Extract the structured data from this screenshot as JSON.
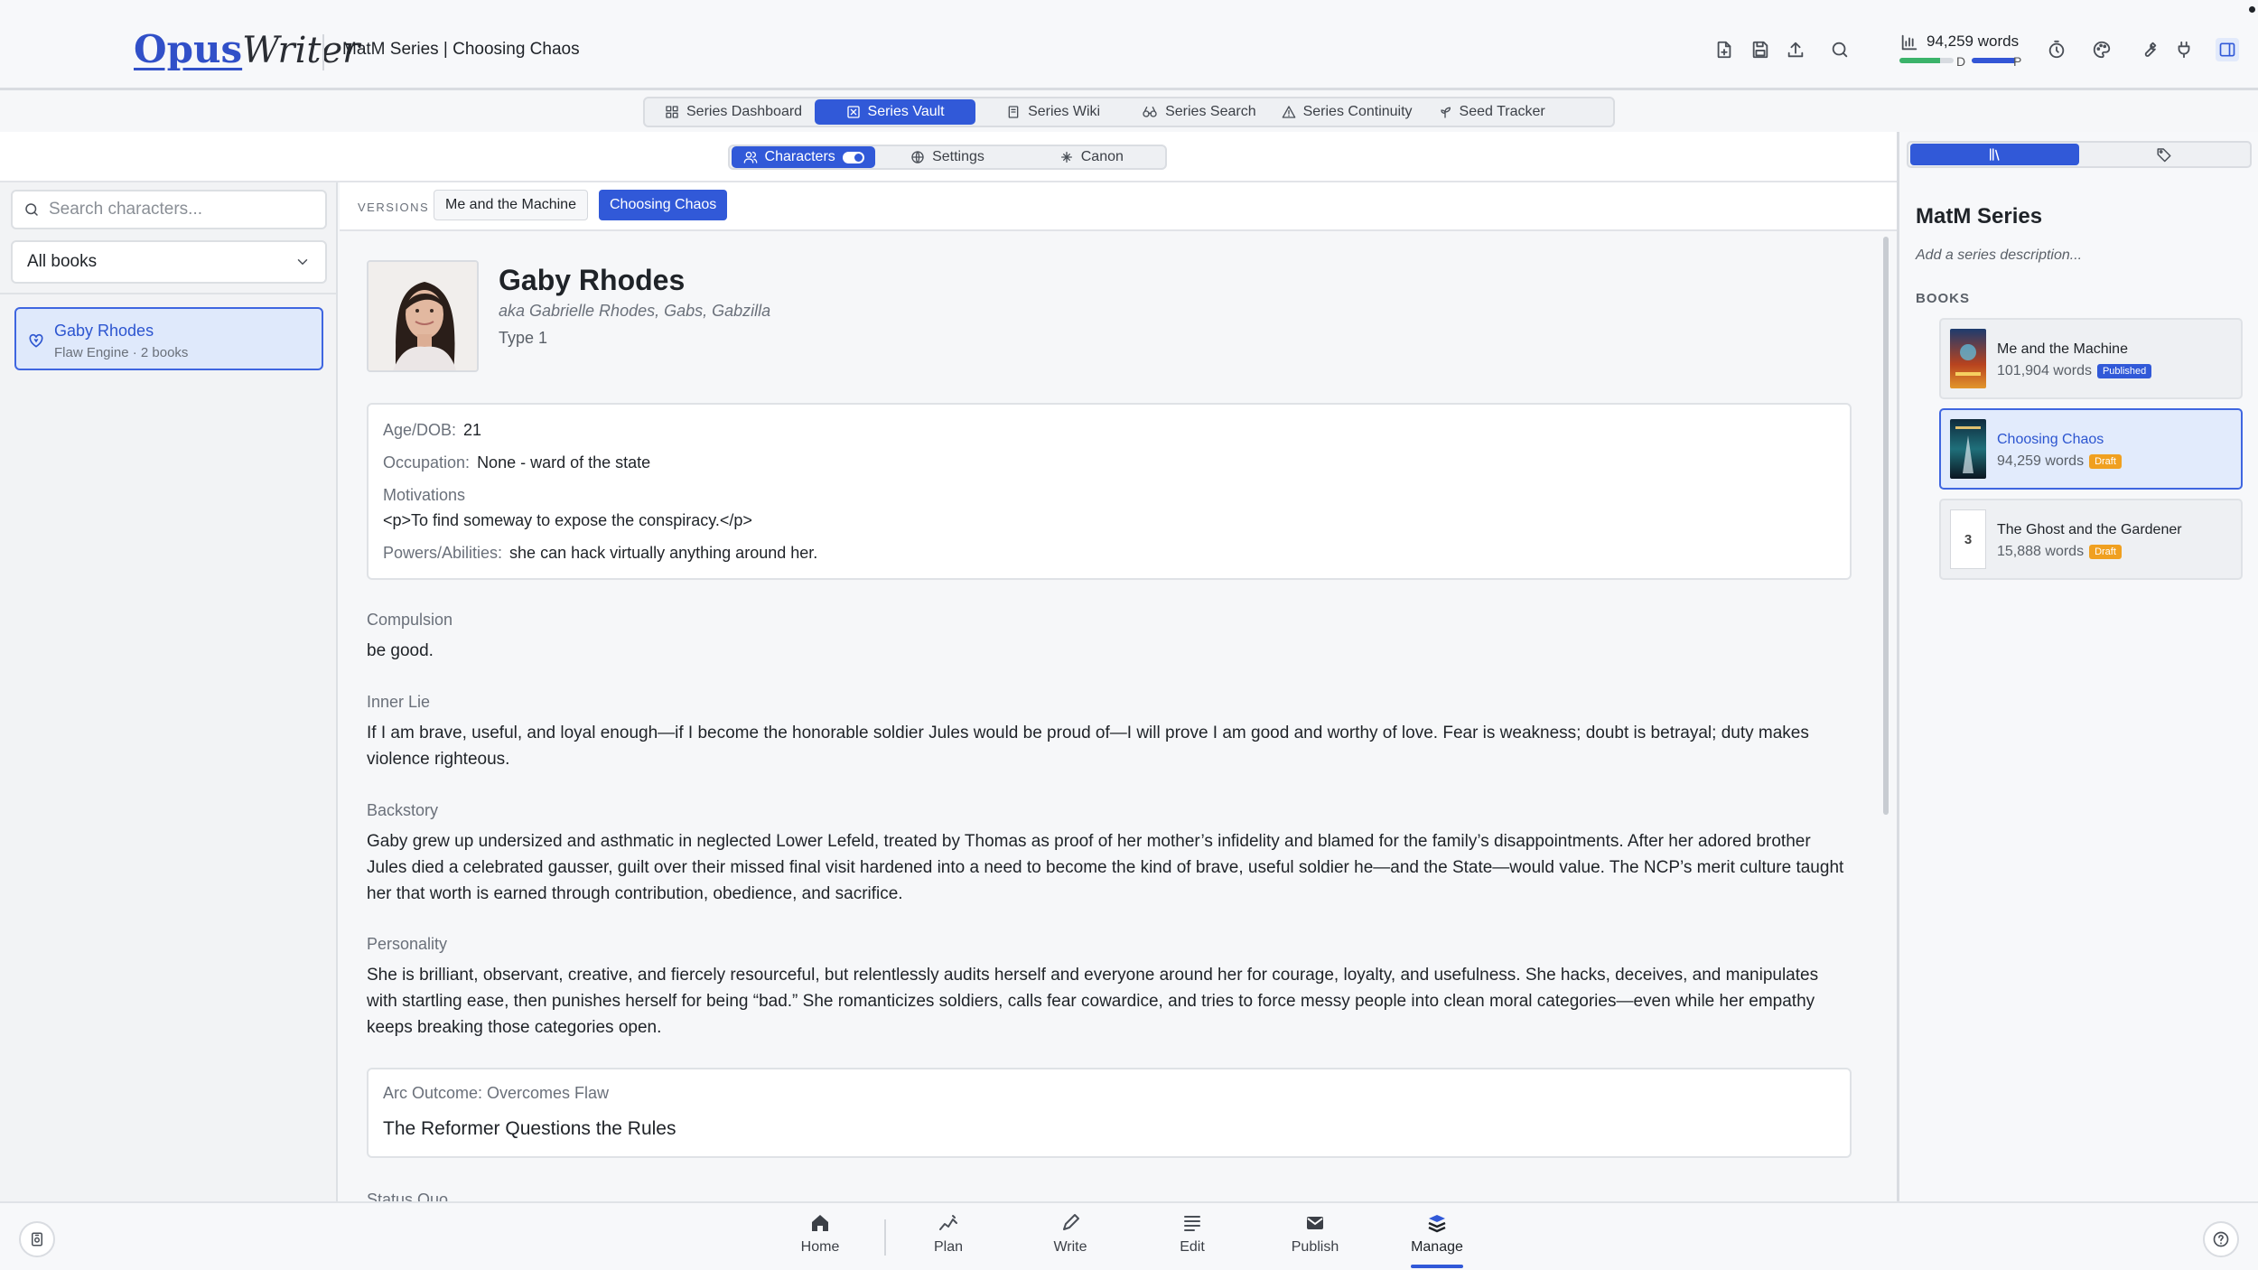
{
  "app": {
    "logo_main": "Opus",
    "logo_script": "Writer",
    "title": "MatM Series | Choosing Chaos",
    "word_count": "94,259 words",
    "progress": {
      "d_label": "D",
      "d_fraction": 0.75,
      "p_label": "P",
      "p_fraction": 0.95
    }
  },
  "series_nav": [
    {
      "label": "Series Dashboard",
      "icon": "grid-icon"
    },
    {
      "label": "Series Vault",
      "icon": "vault-icon",
      "active": true
    },
    {
      "label": "Series Wiki",
      "icon": "book-icon"
    },
    {
      "label": "Series Search",
      "icon": "binoculars-icon"
    },
    {
      "label": "Series Continuity",
      "icon": "warning-icon"
    },
    {
      "label": "Seed Tracker",
      "icon": "sprout-icon"
    }
  ],
  "vault_tabs": [
    {
      "label": "Characters",
      "icon": "users-icon",
      "active": true
    },
    {
      "label": "Settings",
      "icon": "globe-icon"
    },
    {
      "label": "Canon",
      "icon": "canon-icon"
    }
  ],
  "sidebar": {
    "search_placeholder": "Search characters...",
    "filter_value": "All books",
    "characters": [
      {
        "name": "Gaby Rhodes",
        "meta": "Flaw Engine · 2 books"
      }
    ]
  },
  "versions": {
    "label": "VERSIONS",
    "items": [
      "Me and the Machine",
      "Choosing Chaos"
    ],
    "active": "Choosing Chaos"
  },
  "character": {
    "name": "Gaby Rhodes",
    "aka": "aka Gabrielle Rhodes, Gabs, Gabzilla",
    "type": "Type 1",
    "age_label": "Age/DOB:",
    "age": "21",
    "occupation_label": "Occupation:",
    "occupation": "None - ward of the state",
    "motivations_label": "Motivations",
    "motivations": "<p>To find someway to expose the conspiracy.</p>",
    "powers_label": "Powers/Abilities:",
    "powers": "she can hack virtually anything around her.",
    "compulsion_label": "Compulsion",
    "compulsion": "be good.",
    "inner_lie_label": "Inner Lie",
    "inner_lie": "If I am brave, useful, and loyal enough—if I become the honorable soldier Jules would be proud of—I will prove I am good and worthy of love. Fear is weakness; doubt is betrayal; duty makes violence righteous.",
    "backstory_label": "Backstory",
    "backstory": "Gaby grew up undersized and asthmatic in neglected Lower Lefeld, treated by Thomas as proof of her mother’s infidelity and blamed for the family’s disappointments. After her adored brother Jules died a celebrated gausser, guilt over their missed final visit hardened into a need to become the kind of brave, useful soldier he—and the State—would value. The NCP’s merit culture taught her that worth is earned through contribution, obedience, and sacrifice.",
    "personality_label": "Personality",
    "personality": "She is brilliant, observant, creative, and fiercely resourceful, but relentlessly audits herself and everyone around her for courage, loyalty, and usefulness. She hacks, deceives, and manipulates with startling ease, then punishes herself for being “bad.” She romanticizes soldiers, calls fear cowardice, and tries to force messy people into clean moral categories—even while her empathy keeps breaking those categories open.",
    "arc_label": "Arc Outcome: Overcomes Flaw",
    "arc_value": "The Reformer Questions the Rules",
    "next_label": "Status Quo"
  },
  "series_panel": {
    "name": "MatM Series",
    "description": "Add a series description...",
    "books_heading": "BOOKS",
    "books": [
      {
        "title": "Me and the Machine",
        "words": "101,904 words",
        "status": "Published"
      },
      {
        "title": "Choosing Chaos",
        "words": "94,259 words",
        "status": "Draft"
      },
      {
        "title": "The Ghost and the Gardener",
        "words": "15,888 words",
        "status": "Draft",
        "number": "3"
      }
    ]
  },
  "bottom_nav": [
    {
      "label": "Home",
      "icon": "home-icon"
    },
    {
      "label": "Plan",
      "icon": "plan-icon"
    },
    {
      "label": "Write",
      "icon": "pen-icon"
    },
    {
      "label": "Edit",
      "icon": "edit-icon"
    },
    {
      "label": "Publish",
      "icon": "mail-icon"
    },
    {
      "label": "Manage",
      "icon": "stack-icon",
      "active": true
    }
  ],
  "colors": {
    "accent": "#3159d8",
    "draft": "#f0a020",
    "progress_d": "#3bb36a"
  }
}
